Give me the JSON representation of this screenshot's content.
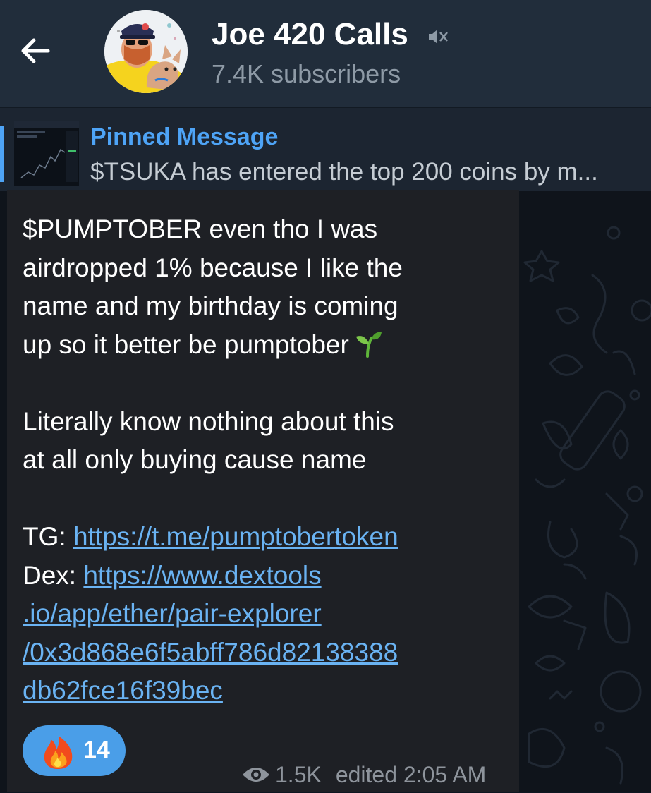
{
  "header": {
    "back_icon": "arrow-left-icon",
    "channel_title": "Joe 420 Calls",
    "mute_icon": "muted-speaker-icon",
    "subscribers": "7.4K subscribers"
  },
  "pinned": {
    "title": "Pinned Message",
    "text": "$TSUKA has entered the top 200 coins by m..."
  },
  "message": {
    "partial_line": "",
    "line1": "$PUMPTOBER even tho I was",
    "line2": "airdropped 1% because I like the",
    "line3": "name and my birthday is coming",
    "line4": "up so it better be pumptober",
    "sprout_icon": "seedling-emoji",
    "line5": "Literally know nothing about this",
    "line6": "at all only buying cause name",
    "tg_label": "TG: ",
    "tg_link": "https://t.me/pumptobertoken",
    "dex_label": "Dex: ",
    "dex_link_1": "https://www.dextools",
    "dex_link_2": ".io/app/ether/pair-explorer",
    "dex_link_3": "/0x3d868e6f5abff786d82138388",
    "dex_link_4": "db62fce16f39bec"
  },
  "reaction": {
    "emoji": "fire-emoji",
    "count": "14"
  },
  "meta": {
    "eye_icon": "eye-icon",
    "views": "1.5K",
    "edited": "edited 2:05 AM"
  },
  "colors": {
    "header_bg": "#212d3b",
    "link": "#6ab3f3",
    "pinned_title": "#4ea4f6",
    "reaction_bg": "#4a9ee8",
    "bubble_bg": "#1e2025"
  }
}
